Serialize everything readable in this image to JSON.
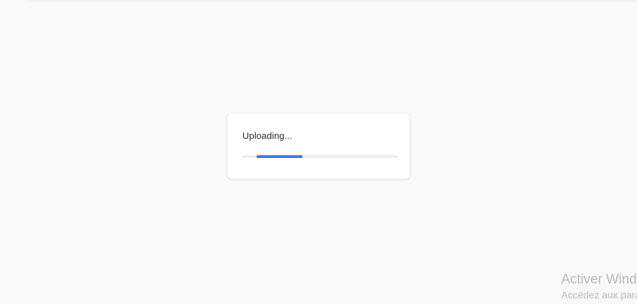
{
  "dialog": {
    "status_text": "Uploading...",
    "progress": {
      "start_fraction": 0.09,
      "end_fraction": 0.39
    }
  },
  "watermark": {
    "title": "Activer Windows",
    "subtitle": "Accédez aux paramètres pour activer Windows."
  },
  "colors": {
    "background": "#f9f9f9",
    "accent": "#3b7fe0",
    "track": "#eeeeee"
  }
}
